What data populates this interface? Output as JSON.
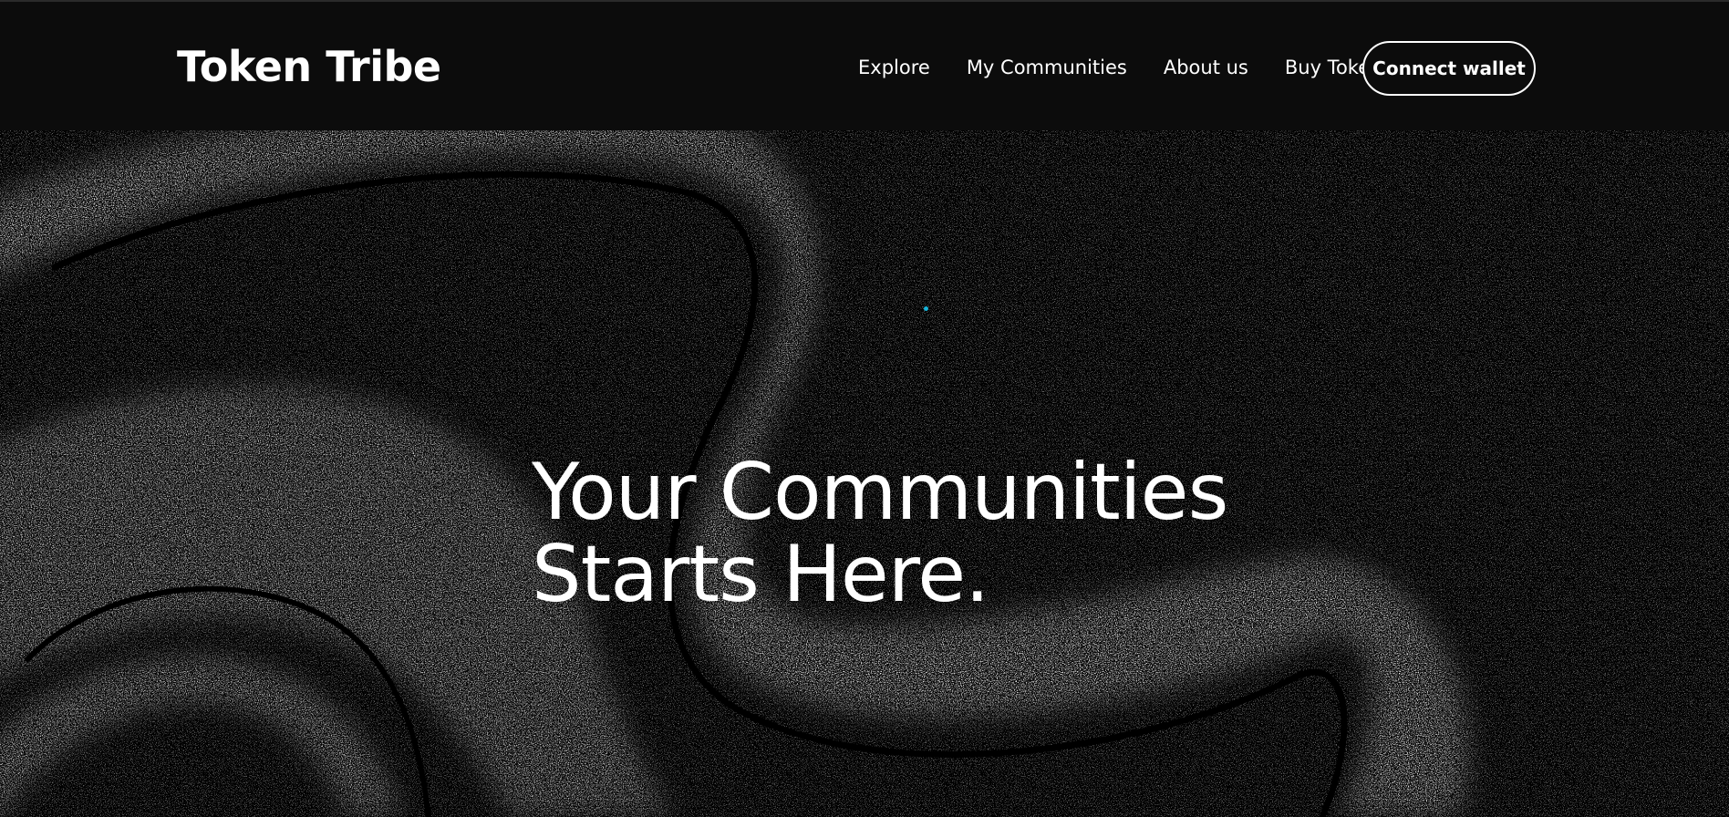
{
  "app": {
    "brand": "Token Tribe"
  },
  "nav": {
    "links": [
      {
        "label": "Explore"
      },
      {
        "label": "My Communities"
      },
      {
        "label": "About us"
      },
      {
        "label": "Buy Token"
      }
    ],
    "connect_wallet_label": "Connect wallet"
  },
  "hero": {
    "title_line1": "Your Communities",
    "title_line2": "Starts Here.",
    "background": "abstract-grain-swirl",
    "accent_dot_color": "#18b4d8"
  },
  "colors": {
    "navbar_bg": "#0c0c0c",
    "page_bg": "#000000",
    "text": "#ffffff"
  }
}
